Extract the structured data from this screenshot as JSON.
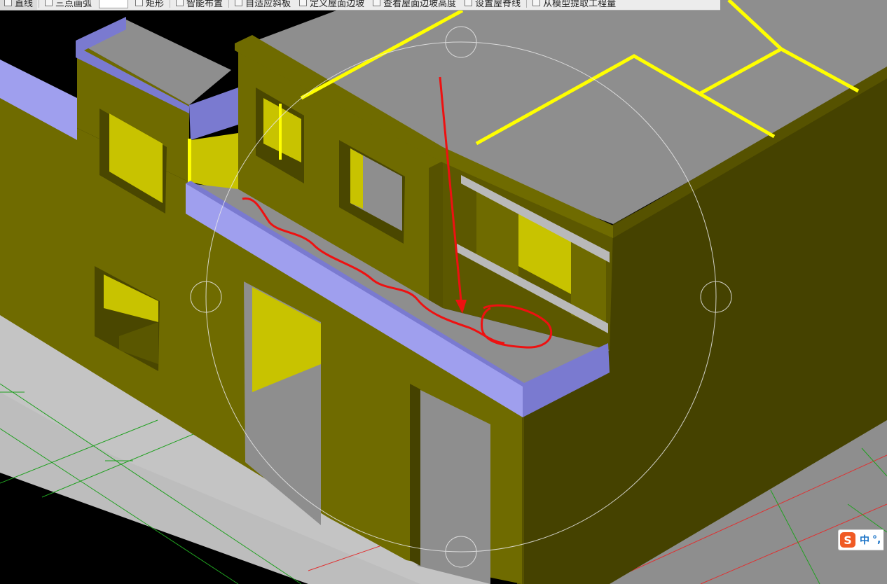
{
  "toolbar": {
    "items": [
      {
        "label": "直线",
        "icon": "line-icon"
      },
      {
        "label": "三点画弧",
        "icon": "arc-icon"
      },
      {
        "label": "矩形",
        "icon": "rectangle-icon"
      },
      {
        "label": "智能布置",
        "icon": "smart-layout-icon"
      },
      {
        "label": "自适应斜板",
        "icon": "adaptive-slab-icon"
      },
      {
        "label": "定义屋面边坡",
        "icon": "define-roof-slope-icon"
      },
      {
        "label": "查看屋面边坡高度",
        "icon": "view-slope-height-icon"
      },
      {
        "label": "设置屋脊线",
        "icon": "ridge-line-icon"
      },
      {
        "label": "从模型提取工程量",
        "icon": "extract-quantity-icon"
      }
    ]
  },
  "ime": {
    "logo": "S",
    "lang": "中",
    "punct": "°,"
  },
  "colors": {
    "wall": "#6f6b00",
    "wall_dark": "#4a4700",
    "wall_shadow": "#403d00",
    "slab": "#8e8e8e",
    "parapet": "#9f9fee",
    "parapet_dark": "#7a7ad0",
    "window": "#c8c300",
    "highlight": "#ffff00",
    "ground": "#c4c4c4",
    "annotation": "#ee1111",
    "grid_red": "#e03030",
    "grid_green": "#20a020"
  }
}
